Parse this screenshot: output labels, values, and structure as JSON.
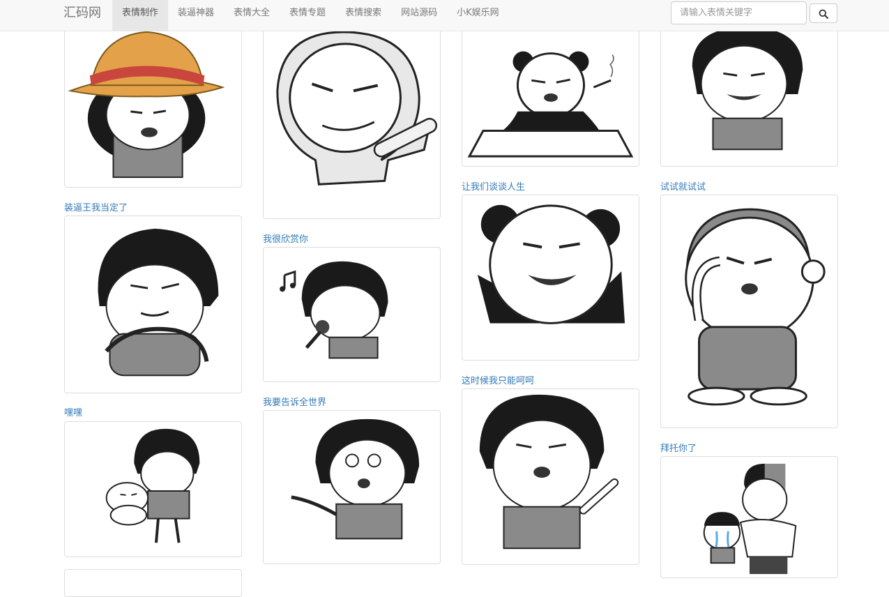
{
  "brand": "汇码网",
  "nav": [
    "表情制作",
    "装逼神器",
    "表情大全",
    "表情专题",
    "表情搜索",
    "网站源码",
    "小K娱乐网"
  ],
  "search": {
    "placeholder": "请输入表情关键字",
    "icon": "search-icon"
  },
  "captions": {
    "c1": "装逼王我当定了",
    "c2": "嘿嘿",
    "c3": "我很欣赏你",
    "c4": "我要告诉全世界",
    "c5": "让我们谈谈人生",
    "c6": "这时候我只能呵呵",
    "c7": "试试就试试",
    "c8": "拜托你了"
  }
}
